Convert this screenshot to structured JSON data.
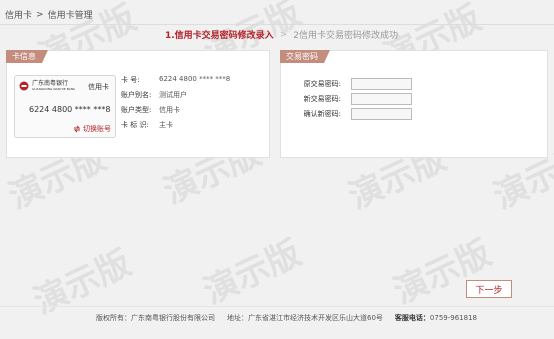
{
  "breadcrumb": [
    "信用卡",
    ">",
    "信用卡管理"
  ],
  "steps": {
    "active": "1.信用卡交易密码修改录入",
    "arrow": ">",
    "inactive": "2信用卡交易密码修改成功"
  },
  "card_info_panel": {
    "title": "卡信息",
    "card_visual": {
      "bank_name_line1": "广东南粤银行",
      "bank_name_line2": "GUANGDONG NANYUE BANK",
      "card_type": "信用卡",
      "card_number": "6224 4800 **** ***8",
      "switch_label": "切换账号"
    },
    "fields": [
      {
        "key": "卡  号:",
        "value": "6224 4800 **** ***8"
      },
      {
        "key": "账户别名:",
        "value": "测试用户"
      },
      {
        "key": "账户类型:",
        "value": "信用卡"
      },
      {
        "key": "卡 标 识:",
        "value": "主卡"
      }
    ]
  },
  "password_panel": {
    "title": "交易密码",
    "fields": [
      {
        "label": "原交易密码:",
        "value": ""
      },
      {
        "label": "新交易密码:",
        "value": ""
      },
      {
        "label": "确认新密码:",
        "value": ""
      }
    ]
  },
  "next_button": "下一步",
  "footer": {
    "copyright": "版权所有：广东南粤银行股份有限公司",
    "address": "地址：广东省湛江市经济技术开发区乐山大道60号",
    "hotline_label": "客服电话：",
    "hotline": "0759-961818"
  },
  "watermark_text": "演示版",
  "colors": {
    "accent": "#b3232a",
    "tab": "#c48c7d"
  }
}
